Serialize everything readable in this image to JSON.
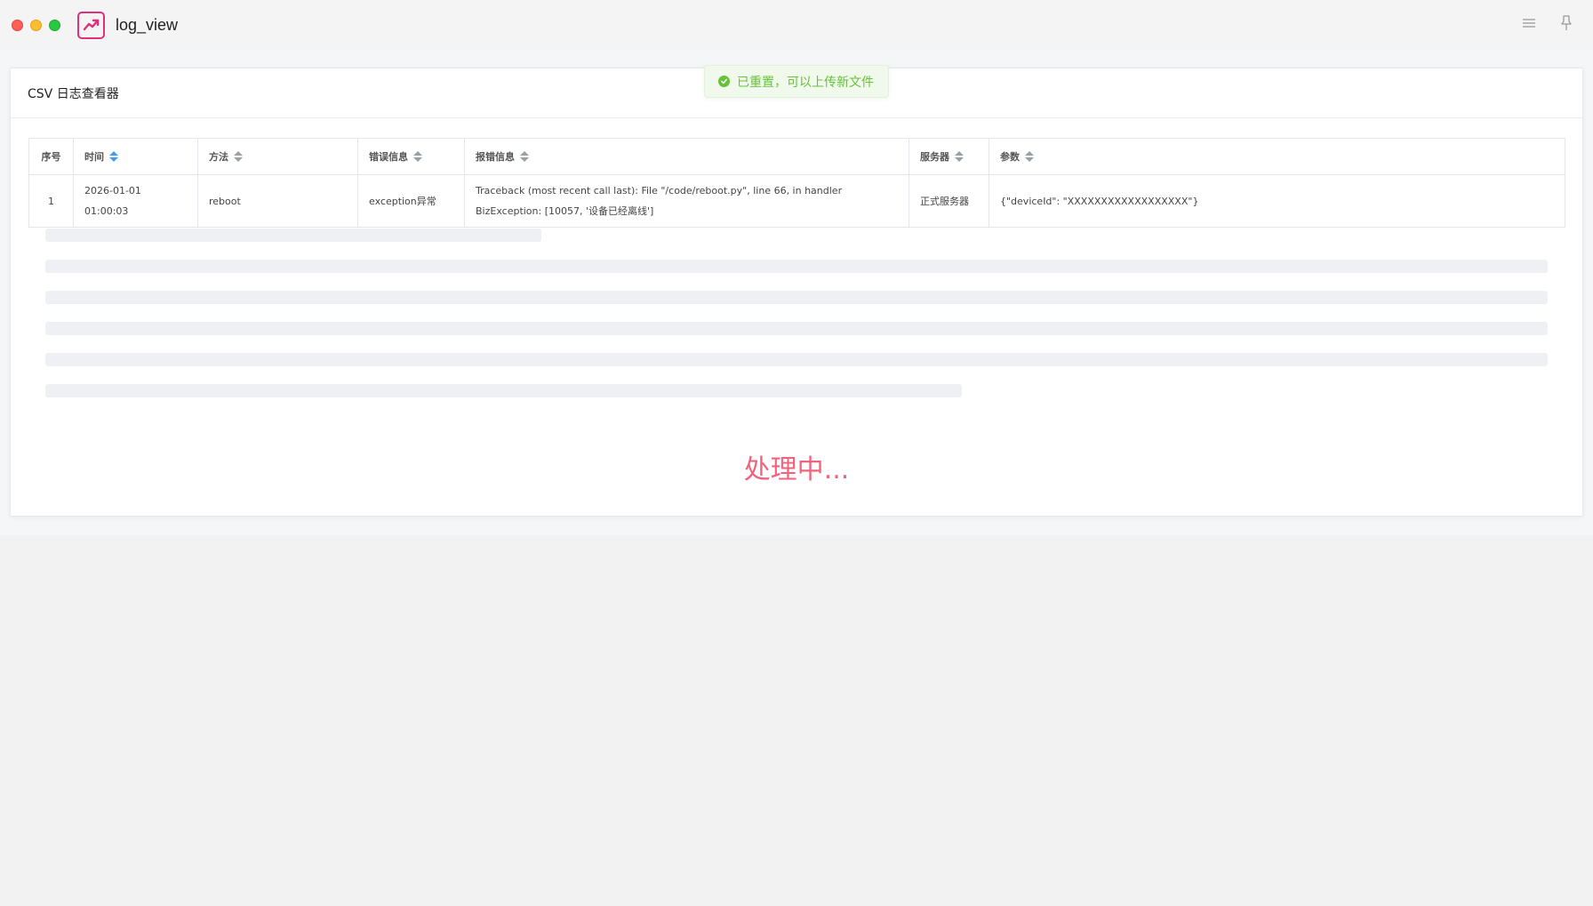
{
  "window": {
    "title": "log_view",
    "icons": [
      "close-dot",
      "minimize-dot",
      "maximize-dot",
      "app-logo-icon",
      "menu-icon",
      "pin-icon"
    ]
  },
  "card": {
    "title": "CSV 日志查看器"
  },
  "toast": {
    "message": "已重置，可以上传新文件",
    "icon": "check-circle-icon",
    "color": "#67c23a"
  },
  "table": {
    "columns": [
      {
        "label": "序号",
        "sortable": false
      },
      {
        "label": "时间",
        "sortable": true,
        "active": true
      },
      {
        "label": "方法",
        "sortable": true
      },
      {
        "label": "错误信息",
        "sortable": true
      },
      {
        "label": "报错信息",
        "sortable": true
      },
      {
        "label": "服务器",
        "sortable": true
      },
      {
        "label": "参数",
        "sortable": true
      }
    ],
    "rows": [
      {
        "index": "1",
        "time": "2026-01-01 01:00:03",
        "method": "reboot",
        "error": "exception异常",
        "traceback": "Traceback (most recent call last): File \"/code/reboot.py\", line 66, in handler BizException: [10057, '设备已经离线']",
        "server": "正式服务器",
        "params": "{\"deviceId\": \"XXXXXXXXXXXXXXXXXX\"}"
      }
    ]
  },
  "status": {
    "processing_text": "处理中...",
    "color": "#f2637b"
  },
  "colors": {
    "accent": "#409eff",
    "logo": "#e0307a"
  }
}
